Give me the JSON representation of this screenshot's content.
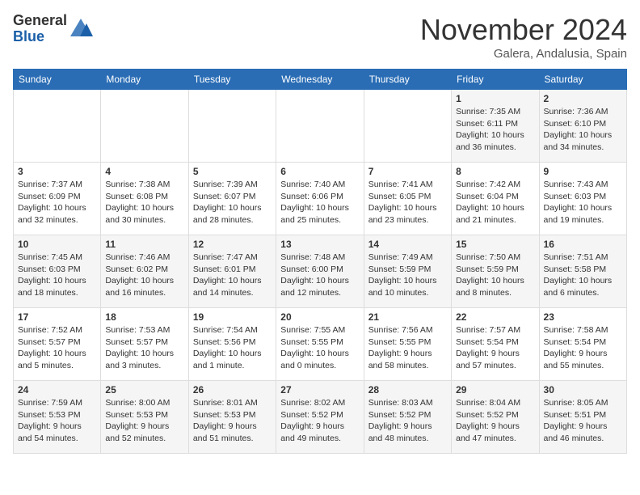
{
  "header": {
    "logo_general": "General",
    "logo_blue": "Blue",
    "month": "November 2024",
    "location": "Galera, Andalusia, Spain"
  },
  "days_of_week": [
    "Sunday",
    "Monday",
    "Tuesday",
    "Wednesday",
    "Thursday",
    "Friday",
    "Saturday"
  ],
  "weeks": [
    [
      {
        "day": "",
        "info": ""
      },
      {
        "day": "",
        "info": ""
      },
      {
        "day": "",
        "info": ""
      },
      {
        "day": "",
        "info": ""
      },
      {
        "day": "",
        "info": ""
      },
      {
        "day": "1",
        "info": "Sunrise: 7:35 AM\nSunset: 6:11 PM\nDaylight: 10 hours\nand 36 minutes."
      },
      {
        "day": "2",
        "info": "Sunrise: 7:36 AM\nSunset: 6:10 PM\nDaylight: 10 hours\nand 34 minutes."
      }
    ],
    [
      {
        "day": "3",
        "info": "Sunrise: 7:37 AM\nSunset: 6:09 PM\nDaylight: 10 hours\nand 32 minutes."
      },
      {
        "day": "4",
        "info": "Sunrise: 7:38 AM\nSunset: 6:08 PM\nDaylight: 10 hours\nand 30 minutes."
      },
      {
        "day": "5",
        "info": "Sunrise: 7:39 AM\nSunset: 6:07 PM\nDaylight: 10 hours\nand 28 minutes."
      },
      {
        "day": "6",
        "info": "Sunrise: 7:40 AM\nSunset: 6:06 PM\nDaylight: 10 hours\nand 25 minutes."
      },
      {
        "day": "7",
        "info": "Sunrise: 7:41 AM\nSunset: 6:05 PM\nDaylight: 10 hours\nand 23 minutes."
      },
      {
        "day": "8",
        "info": "Sunrise: 7:42 AM\nSunset: 6:04 PM\nDaylight: 10 hours\nand 21 minutes."
      },
      {
        "day": "9",
        "info": "Sunrise: 7:43 AM\nSunset: 6:03 PM\nDaylight: 10 hours\nand 19 minutes."
      }
    ],
    [
      {
        "day": "10",
        "info": "Sunrise: 7:45 AM\nSunset: 6:03 PM\nDaylight: 10 hours\nand 18 minutes."
      },
      {
        "day": "11",
        "info": "Sunrise: 7:46 AM\nSunset: 6:02 PM\nDaylight: 10 hours\nand 16 minutes."
      },
      {
        "day": "12",
        "info": "Sunrise: 7:47 AM\nSunset: 6:01 PM\nDaylight: 10 hours\nand 14 minutes."
      },
      {
        "day": "13",
        "info": "Sunrise: 7:48 AM\nSunset: 6:00 PM\nDaylight: 10 hours\nand 12 minutes."
      },
      {
        "day": "14",
        "info": "Sunrise: 7:49 AM\nSunset: 5:59 PM\nDaylight: 10 hours\nand 10 minutes."
      },
      {
        "day": "15",
        "info": "Sunrise: 7:50 AM\nSunset: 5:59 PM\nDaylight: 10 hours\nand 8 minutes."
      },
      {
        "day": "16",
        "info": "Sunrise: 7:51 AM\nSunset: 5:58 PM\nDaylight: 10 hours\nand 6 minutes."
      }
    ],
    [
      {
        "day": "17",
        "info": "Sunrise: 7:52 AM\nSunset: 5:57 PM\nDaylight: 10 hours\nand 5 minutes."
      },
      {
        "day": "18",
        "info": "Sunrise: 7:53 AM\nSunset: 5:57 PM\nDaylight: 10 hours\nand 3 minutes."
      },
      {
        "day": "19",
        "info": "Sunrise: 7:54 AM\nSunset: 5:56 PM\nDaylight: 10 hours\nand 1 minute."
      },
      {
        "day": "20",
        "info": "Sunrise: 7:55 AM\nSunset: 5:55 PM\nDaylight: 10 hours\nand 0 minutes."
      },
      {
        "day": "21",
        "info": "Sunrise: 7:56 AM\nSunset: 5:55 PM\nDaylight: 9 hours\nand 58 minutes."
      },
      {
        "day": "22",
        "info": "Sunrise: 7:57 AM\nSunset: 5:54 PM\nDaylight: 9 hours\nand 57 minutes."
      },
      {
        "day": "23",
        "info": "Sunrise: 7:58 AM\nSunset: 5:54 PM\nDaylight: 9 hours\nand 55 minutes."
      }
    ],
    [
      {
        "day": "24",
        "info": "Sunrise: 7:59 AM\nSunset: 5:53 PM\nDaylight: 9 hours\nand 54 minutes."
      },
      {
        "day": "25",
        "info": "Sunrise: 8:00 AM\nSunset: 5:53 PM\nDaylight: 9 hours\nand 52 minutes."
      },
      {
        "day": "26",
        "info": "Sunrise: 8:01 AM\nSunset: 5:53 PM\nDaylight: 9 hours\nand 51 minutes."
      },
      {
        "day": "27",
        "info": "Sunrise: 8:02 AM\nSunset: 5:52 PM\nDaylight: 9 hours\nand 49 minutes."
      },
      {
        "day": "28",
        "info": "Sunrise: 8:03 AM\nSunset: 5:52 PM\nDaylight: 9 hours\nand 48 minutes."
      },
      {
        "day": "29",
        "info": "Sunrise: 8:04 AM\nSunset: 5:52 PM\nDaylight: 9 hours\nand 47 minutes."
      },
      {
        "day": "30",
        "info": "Sunrise: 8:05 AM\nSunset: 5:51 PM\nDaylight: 9 hours\nand 46 minutes."
      }
    ]
  ]
}
